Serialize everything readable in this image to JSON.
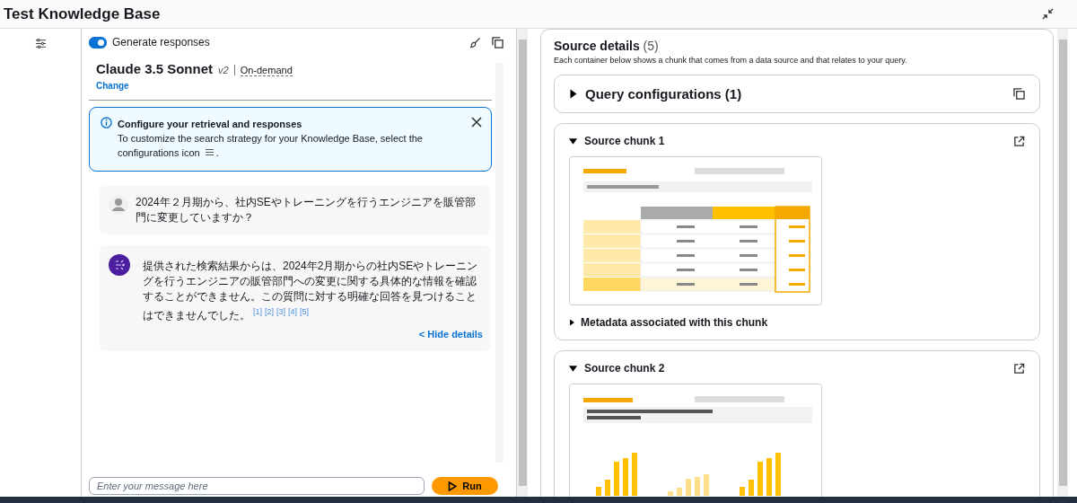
{
  "header": {
    "title": "Test Knowledge Base"
  },
  "chat": {
    "generate_responses": {
      "label": "Generate responses",
      "on": true
    },
    "model": {
      "name": "Claude 3.5 Sonnet",
      "version": "v2",
      "mode": "On-demand",
      "change_link": "Change"
    },
    "alert": {
      "title": "Configure your retrieval and responses",
      "text": "To customize the search strategy for your Knowledge Base, select the",
      "text_2": "configurations icon",
      "text_end": "."
    },
    "messages": [
      {
        "kind": "user",
        "text": "2024年２月期から、社内SEやトレーニングを行うエンジニアを販管部門に変更していますか？"
      },
      {
        "kind": "assistant",
        "text": "提供された検索結果からは、2024年2月期からの社内SEやトレーニングを行うエンジニアの販管部門への変更に関する具体的な情報を確認することができません。この質問に対する明確な回答を見つけることはできませんでした。",
        "citations": [
          "[1]",
          "[2]",
          "[3]",
          "[4]",
          "[5]"
        ],
        "toggle": "< Hide details"
      }
    ],
    "input": {
      "placeholder": "Enter your message here"
    },
    "run_button": "Run"
  },
  "sources": {
    "title": "Source details",
    "count": "(5)",
    "description": "Each container below shows a chunk that comes from a data source and that relates to your query.",
    "query_config": {
      "label": "Query configurations (1)",
      "expanded": false
    },
    "chunks": [
      {
        "label": "Source chunk 1",
        "expanded": true,
        "kind": "table",
        "metadata": {
          "label": "Metadata associated with this chunk",
          "expanded": false
        }
      },
      {
        "label": "Source chunk 2",
        "expanded": true,
        "kind": "chart"
      }
    ]
  }
}
